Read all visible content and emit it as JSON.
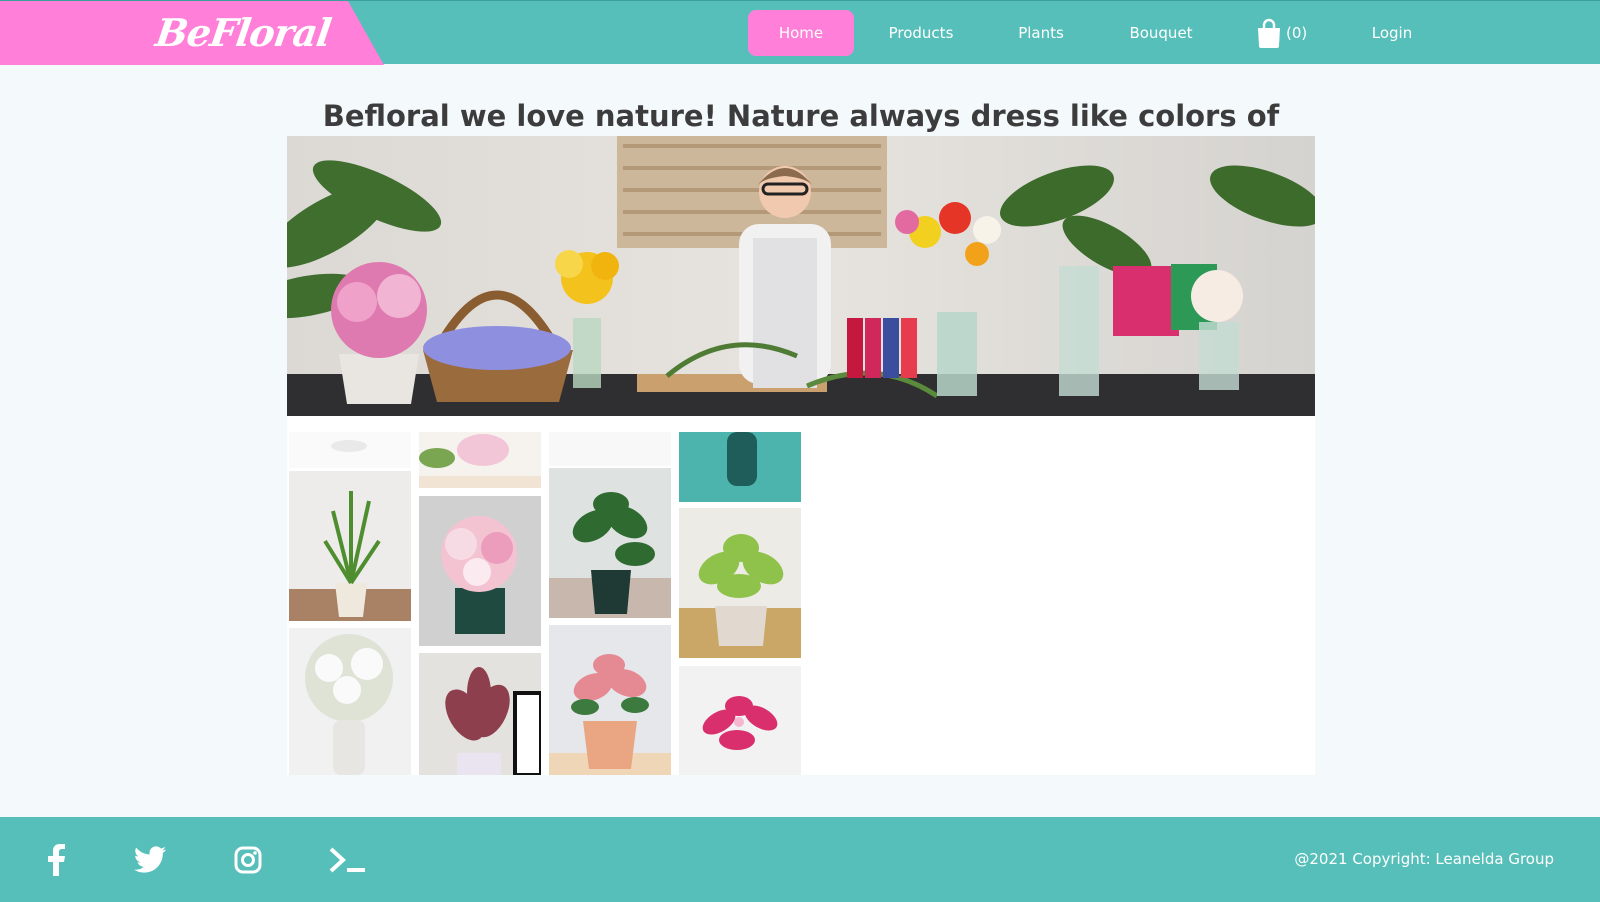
{
  "brand": {
    "name": "BeFloral"
  },
  "nav": {
    "items": [
      {
        "label": "Home",
        "active": true
      },
      {
        "label": "Products"
      },
      {
        "label": "Plants"
      },
      {
        "label": "Bouquet"
      }
    ],
    "cart_count": "(0)",
    "login_label": "Login"
  },
  "main": {
    "headline": "Befloral we love nature! Nature always dress like colors of spirite!"
  },
  "footer": {
    "copyright": "@2021 Copyright: Leanelda Group",
    "social_icons": [
      "facebook-icon",
      "twitter-icon",
      "instagram-icon",
      "terminal-icon"
    ]
  },
  "colors": {
    "header_bg": "#56bfba",
    "brand_pink": "#ff7fd9",
    "page_bg": "#f4f9fc"
  }
}
